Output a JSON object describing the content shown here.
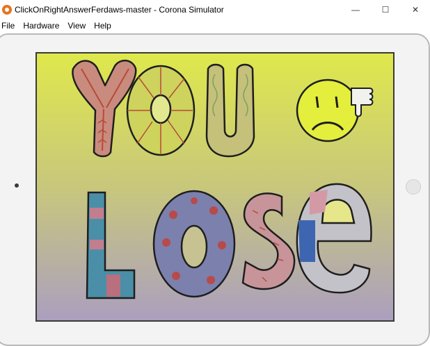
{
  "window": {
    "title": "ClickOnRightAnswerFerdaws-master - Corona Simulator",
    "minimize_glyph": "—",
    "maximize_glyph": "☐",
    "close_glyph": "✕"
  },
  "menu": {
    "items": [
      {
        "label": "File"
      },
      {
        "label": "Hardware"
      },
      {
        "label": "View"
      },
      {
        "label": "Help"
      }
    ]
  },
  "screen": {
    "top_word": "YOU",
    "bottom_word": "LOSE"
  },
  "colors": {
    "screen_gradient_top": "#dfe84c",
    "screen_gradient_bottom": "#ab9fbf",
    "letter_y": "#c98b7e",
    "letter_o": "#cdd35d",
    "letter_u": "#c5c07a",
    "face": "#e4ee3c",
    "letter_l": "#4a8fa7",
    "letter_o2": "#7c80ad",
    "letter_s": "#c7949a",
    "letter_e": "#c2c2c8"
  },
  "icons": {
    "app": "corona-logo-icon",
    "face": "sad-face-icon",
    "thumb": "thumbs-down-icon"
  }
}
